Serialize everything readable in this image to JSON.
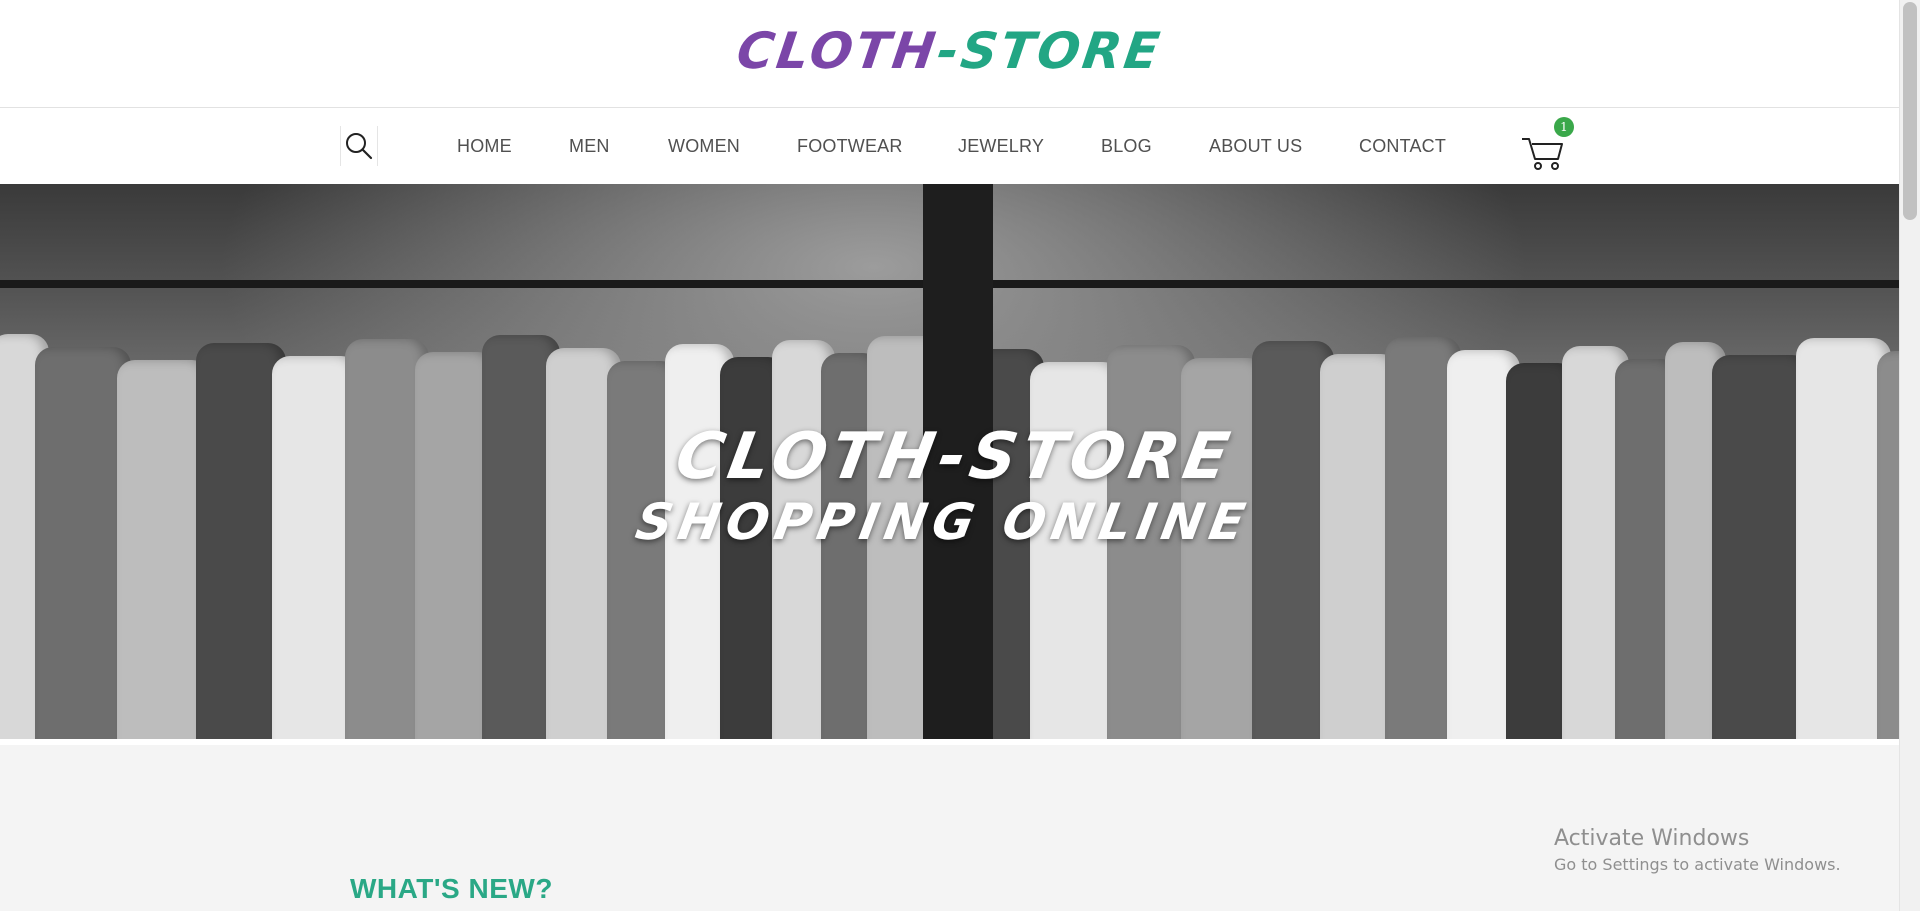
{
  "header": {
    "logo_part1": "CLOTH",
    "logo_separator": "-",
    "logo_part2": "STORE",
    "logo_colors": {
      "part1": "#7b46a8",
      "part2": "#22a684"
    }
  },
  "nav": {
    "search_icon": "search-icon",
    "items": [
      {
        "label": "HOME"
      },
      {
        "label": "MEN"
      },
      {
        "label": "WOMEN"
      },
      {
        "label": "FOOTWEAR"
      },
      {
        "label": "JEWELRY"
      },
      {
        "label": "BLOG"
      },
      {
        "label": "ABOUT US"
      },
      {
        "label": "CONTACT"
      }
    ],
    "cart": {
      "icon": "cart-icon",
      "count": "1",
      "badge_color": "#3aa84a"
    }
  },
  "hero": {
    "title": "CLOTH-STORE",
    "subtitle": "SHOPPING ONLINE"
  },
  "main": {
    "section_title": "WHAT'S NEW?",
    "accent_color": "#2aa886"
  },
  "watermark": {
    "title": "Activate Windows",
    "subtitle": "Go to Settings to activate Windows."
  }
}
